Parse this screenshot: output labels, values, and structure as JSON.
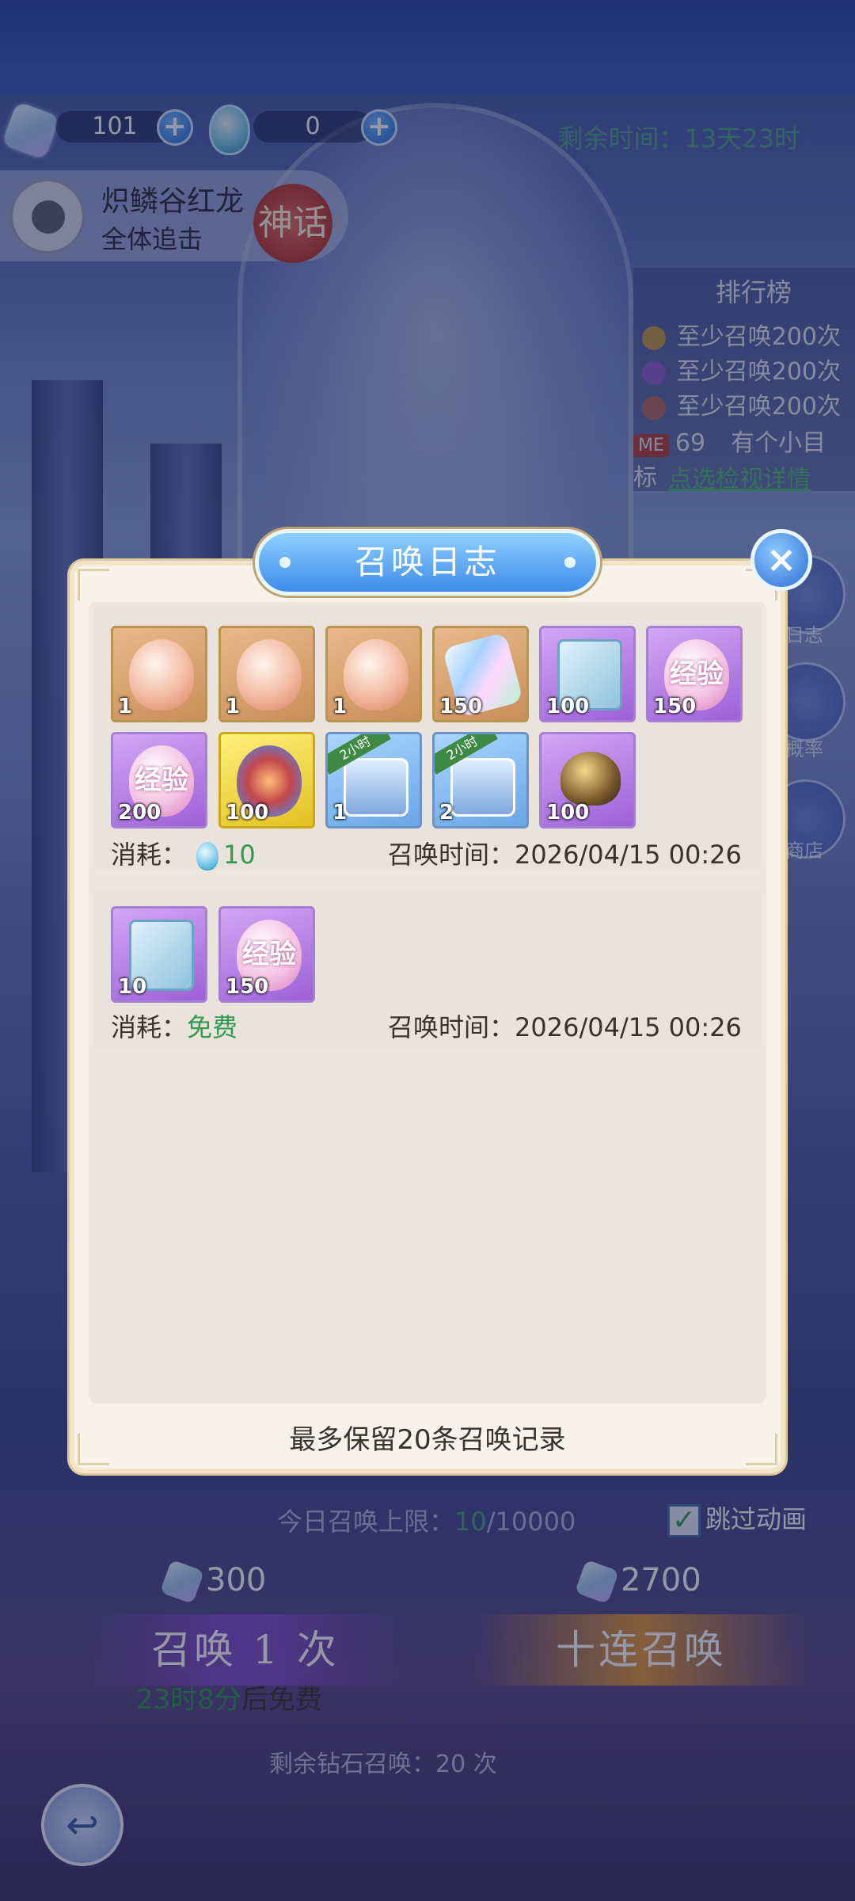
{
  "currency": {
    "gems": "101",
    "tickets": "0",
    "remaining_time": "剩余时间：13天23时"
  },
  "boss": {
    "name": "炽鳞谷红龙",
    "subtitle": "全体追击",
    "badge": "神话"
  },
  "ranking": {
    "title": "排行榜",
    "rows": [
      "至少召唤200次",
      "至少召唤200次",
      "至少召唤200次"
    ],
    "me_badge": "ME",
    "me_rank": "69",
    "me_text": "有个小目标",
    "detail_link": "点选检视详情"
  },
  "side_buttons": {
    "log": "日志",
    "rate": "概率",
    "shop": "商店"
  },
  "modal": {
    "title": "召唤日志",
    "close": "×",
    "records": [
      {
        "items": [
          {
            "kind": "egg",
            "count": "1"
          },
          {
            "kind": "egg",
            "count": "1"
          },
          {
            "kind": "egg",
            "count": "1"
          },
          {
            "kind": "crystal",
            "count": "150"
          },
          {
            "kind": "book",
            "count": "100"
          },
          {
            "kind": "expegg",
            "count": "150",
            "label": "经验"
          },
          {
            "kind": "expegg",
            "count": "200",
            "label": "经验"
          },
          {
            "kind": "dragon",
            "count": "100"
          },
          {
            "kind": "chest-roses",
            "count": "1",
            "tag": "2小时"
          },
          {
            "kind": "chest-gold",
            "count": "2",
            "tag": "2小时"
          },
          {
            "kind": "goldegg",
            "count": "100"
          }
        ],
        "cost_label": "消耗：",
        "cost_value": "10",
        "time_label": "召唤时间：",
        "time_value": "2026/04/15 00:26"
      },
      {
        "items": [
          {
            "kind": "book",
            "count": "10"
          },
          {
            "kind": "expegg",
            "count": "150",
            "label": "经验"
          }
        ],
        "cost_label": "消耗：",
        "cost_value": "免费",
        "time_label": "召唤时间：",
        "time_value": "2026/04/15 00:26"
      }
    ],
    "footer": "最多保留20条召唤记录"
  },
  "bottom": {
    "limit_label": "今日召唤上限：",
    "limit_used": "10",
    "limit_total": "/10000",
    "skip_label": "跳过动画",
    "single_price": "300",
    "ten_price": "2700",
    "single_button": "召唤 1 次",
    "ten_button": "十连召唤",
    "free_time": "23时8分",
    "free_suffix": "后免费",
    "diamond_remaining": "剩余钻石召唤：20 次"
  },
  "colors": {
    "accent_green": "#2e9a4e",
    "modal_bg": "#f7f3ea",
    "title_blue": "#3f8bea"
  }
}
